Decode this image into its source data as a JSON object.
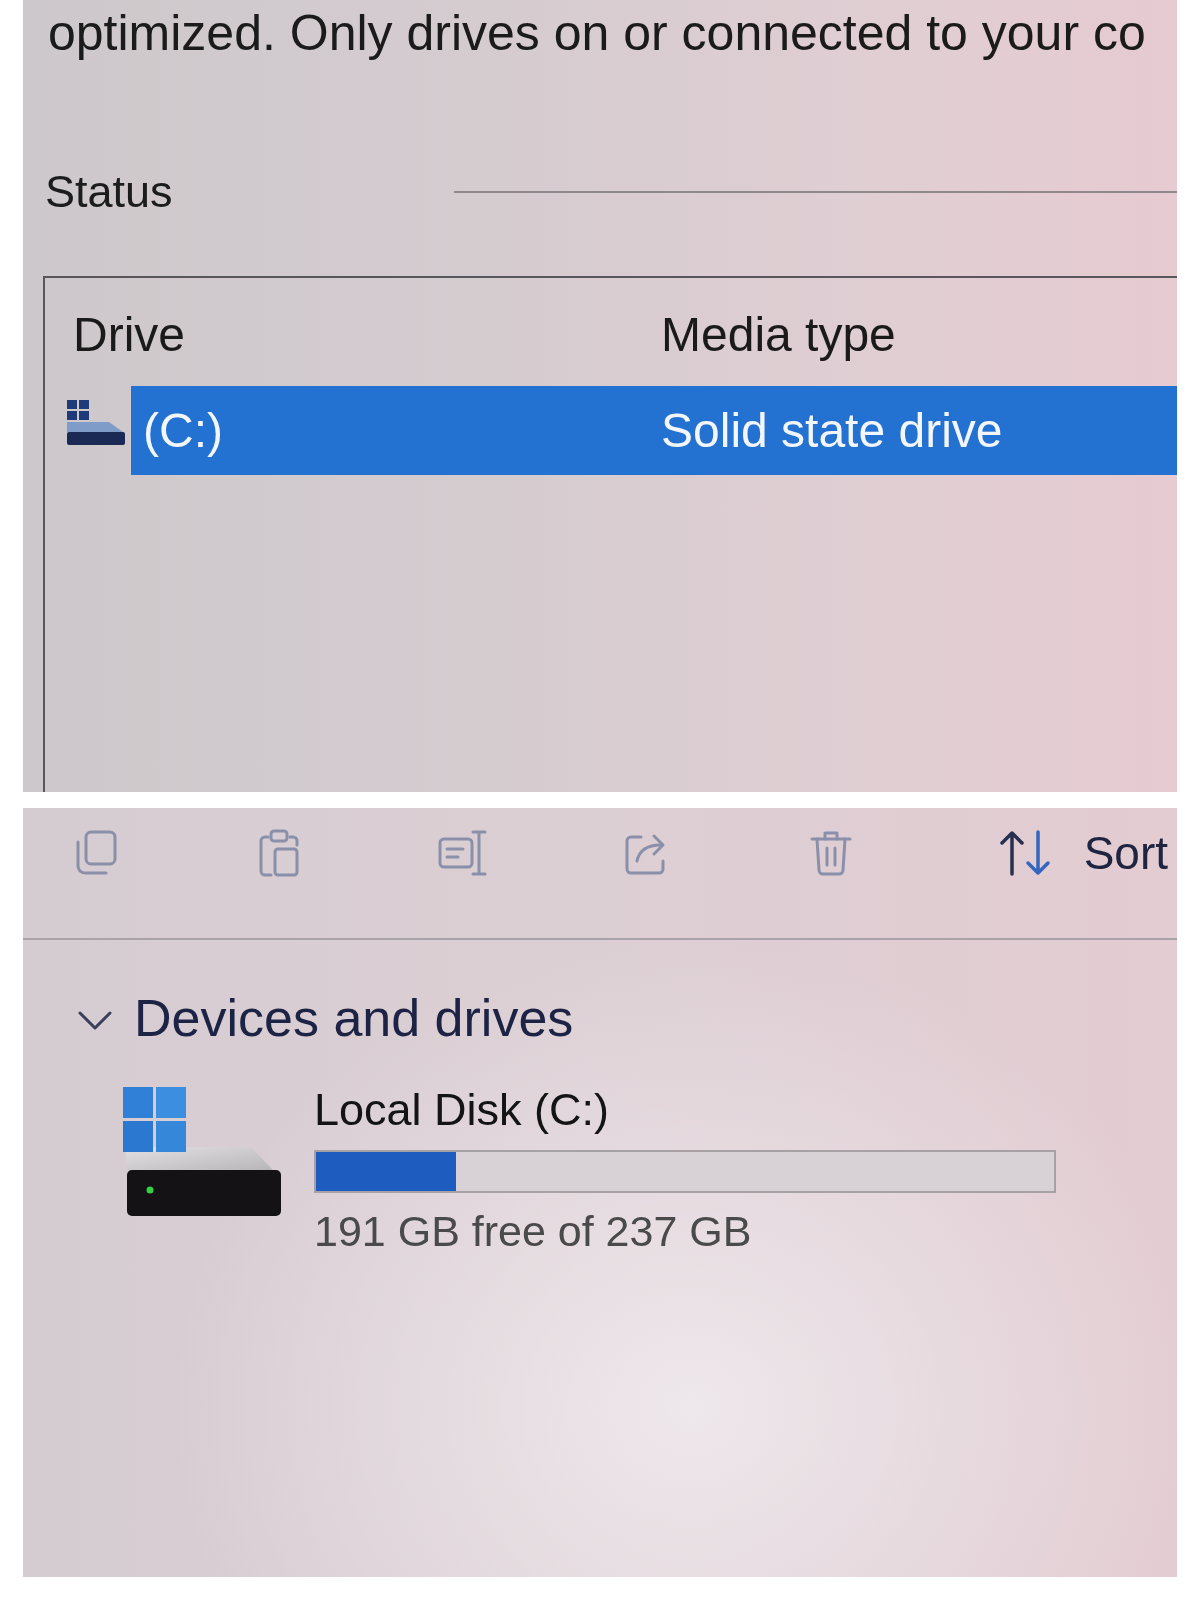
{
  "top_photo": {
    "intro_text": "optimized. Only drives on or connected to your co",
    "status_group": {
      "label": "Status",
      "list": {
        "columns": [
          "Drive",
          "Media type"
        ],
        "rows": [
          {
            "cells": [
              "(C:)",
              "Solid state drive"
            ],
            "selected": true
          }
        ]
      }
    }
  },
  "bottom_photo": {
    "toolbar": {
      "buttons": [
        {
          "disabled": true
        },
        {
          "disabled": true
        },
        {
          "disabled": true
        },
        {
          "disabled": true
        },
        {
          "disabled": true
        }
      ],
      "sort_button": {
        "label": "Sort",
        "disabled": false
      }
    },
    "section": {
      "title": "Devices and drives",
      "expanded": true,
      "drives": [
        {
          "name": "Local Disk (C:)",
          "level": 0.19,
          "free_text": "191 GB free of 237 GB"
        }
      ]
    }
  }
}
